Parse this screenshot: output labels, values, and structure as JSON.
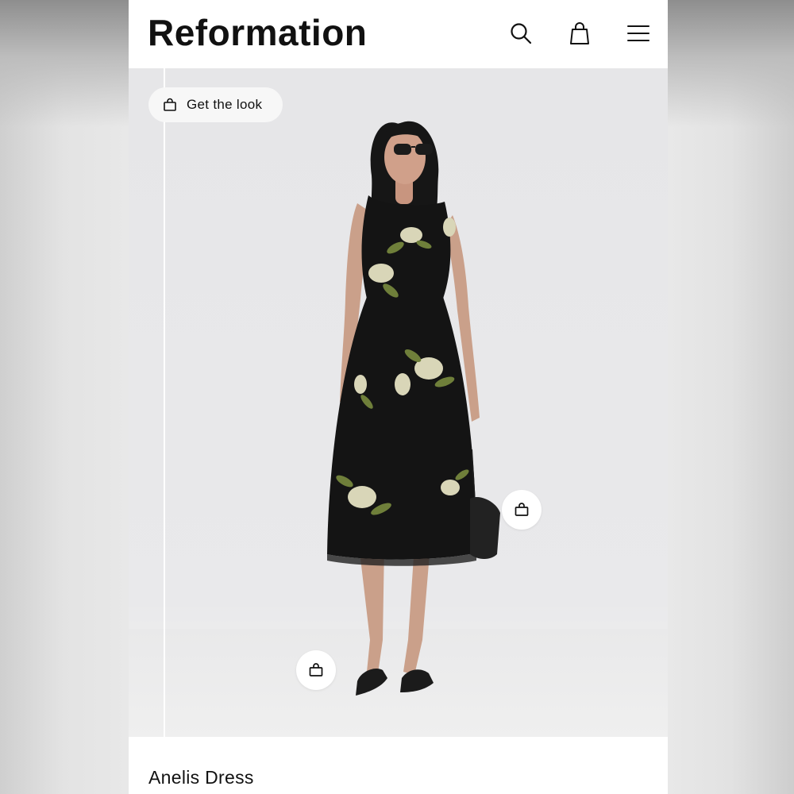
{
  "header": {
    "brand": "Reformation",
    "icons": [
      "search-icon",
      "shopping-bag-icon",
      "menu-icon"
    ]
  },
  "hero": {
    "get_the_look_label": "Get the look",
    "hotspots": [
      "shop-hotspot-bag",
      "shop-hotspot-shoes"
    ]
  },
  "product": {
    "name": "Anelis Dress"
  },
  "colors": {
    "background": "#e8e8e8",
    "header_bg": "#ffffff",
    "hero_bg": "#e8e8ea",
    "text": "#111111",
    "dress": "#141414",
    "floral": "#d9d6b8",
    "leaf": "#6f7f3a"
  }
}
